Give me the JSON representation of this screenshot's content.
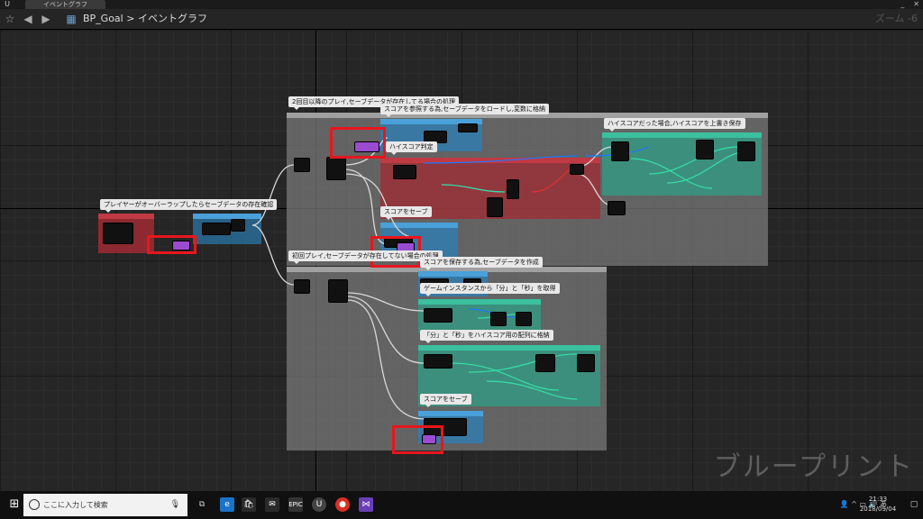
{
  "window": {
    "tab_label": "イベントグラフ",
    "min": "_",
    "close": "✕"
  },
  "toolbar": {
    "breadcrumb_root": "BP_Goal",
    "breadcrumb_sep": ">",
    "breadcrumb_current": "イベントグラフ",
    "zoom": "ズーム -6"
  },
  "comments": {
    "main_top": "2回目以降のプレイ,セーブデータが存在してる場合の処理",
    "load_note": "スコアを参照する為,セーブデータをロードし,変数に格納",
    "hiscore_check": "ハイスコア判定",
    "hiscore_overwrite": "ハイスコアだった場合,ハイスコアを上書き保存",
    "score_save_1": "スコアをセーブ",
    "overlap_check": "プレイヤーがオーバーラップしたらセーブデータの存在確認",
    "first_play": "初回プレイ,セーブデータが存在してない場合の処理",
    "create_save": "スコアを保存する為,セーブデータを作成",
    "get_time": "ゲームインスタンスから「分」と「秒」を取得",
    "store_array": "「分」と「秒」をハイスコア用の配列に格納",
    "score_save_2": "スコアをセーブ"
  },
  "watermark": "ブループリント",
  "taskbar": {
    "search_placeholder": "ここに入力して検索",
    "time": "21:33",
    "date": "2018/09/04",
    "tray_ime": "あ",
    "icons": [
      "task-view",
      "edge",
      "store",
      "mail",
      "epic",
      "unreal",
      "chrome",
      "visual-studio"
    ]
  },
  "colors": {
    "red_box": "#e8161d",
    "teal": "#2f9e84",
    "blue": "#2b7fb8",
    "crimson": "#a02a33"
  }
}
